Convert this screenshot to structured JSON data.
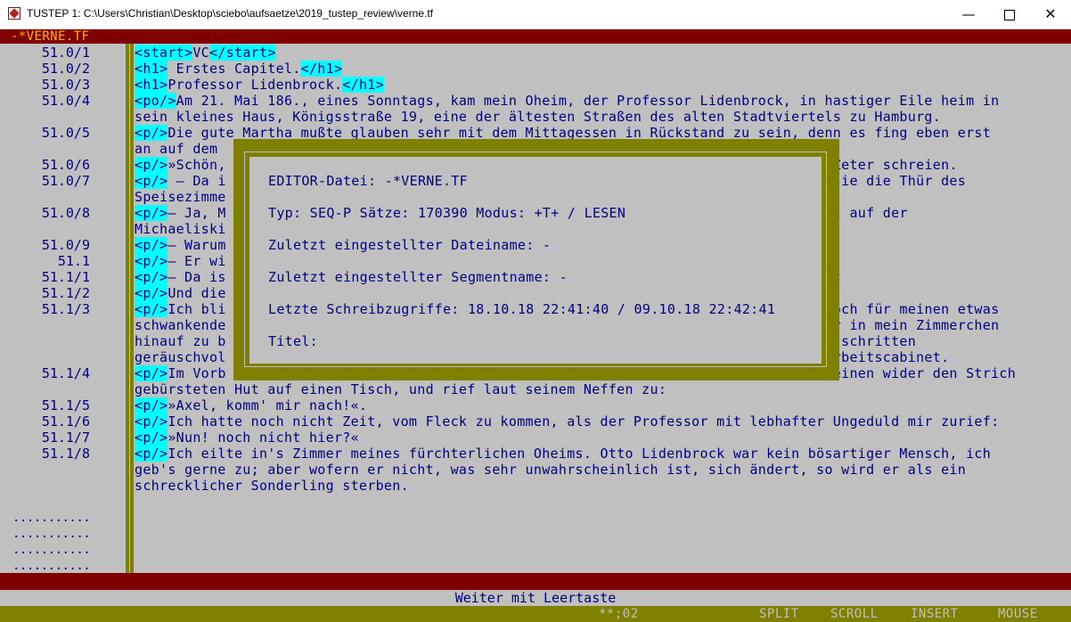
{
  "window": {
    "title": "TUSTEP 1: C:\\Users\\Christian\\Desktop\\sciebo\\aufsaetze\\2019_tustep_review\\verne.tf",
    "minimize": "—",
    "close": "✕"
  },
  "file_label": "-*VERNE.TF",
  "lines": [
    {
      "num": "51.0/1",
      "segs": [
        {
          "t": "<start>",
          "tag": true
        },
        {
          "t": "VC"
        },
        {
          "t": "</start>",
          "tag": true
        }
      ]
    },
    {
      "num": "51.0/2",
      "segs": [
        {
          "t": "<h1>",
          "tag": true
        },
        {
          "t": " Erstes Capitel."
        },
        {
          "t": "</h1>",
          "tag": true
        }
      ]
    },
    {
      "num": "51.0/3",
      "segs": [
        {
          "t": "<h1>",
          "tag": true
        },
        {
          "t": "Professor Lidenbrock."
        },
        {
          "t": "</h1>",
          "tag": true
        }
      ]
    },
    {
      "num": "51.0/4",
      "segs": [
        {
          "t": "<po/>",
          "tag": true
        },
        {
          "t": "Am 21. Mai 186., eines Sonntags, kam mein Oheim, der Professor Lidenbrock, in hastiger Eile heim in"
        }
      ]
    },
    {
      "num": "",
      "segs": [
        {
          "t": "sein kleines Haus, Königsstraße 19, eine der ältesten Straßen des alten Stadtviertels zu Hamburg."
        }
      ]
    },
    {
      "num": "51.0/5",
      "segs": [
        {
          "t": "<p/>",
          "tag": true
        },
        {
          "t": "Die gute Martha mußte glauben sehr mit dem Mittagessen in Rückstand zu sein, denn es fing eben erst"
        }
      ]
    },
    {
      "num": "",
      "segs": [
        {
          "t": "an auf dem"
        }
      ]
    },
    {
      "num": "51.0/6",
      "segs": [
        {
          "t": "<p/>",
          "tag": true
        },
        {
          "t": "»Schön,"
        },
        {
          "t": "                                                                      nn Zeter schreien."
        }
      ]
    },
    {
      "num": "51.0/7",
      "segs": [
        {
          "t": "<p/>",
          "tag": true
        },
        {
          "t": " – Da i"
        },
        {
          "t": "                                                                      em sie die Thür des"
        }
      ]
    },
    {
      "num": "",
      "segs": [
        {
          "t": "Speisezimme"
        }
      ]
    },
    {
      "num": "51.0/8",
      "segs": [
        {
          "t": "<p/>",
          "tag": true
        },
        {
          "t": "– Ja, M"
        },
        {
          "t": "                                                                      erst auf der"
        }
      ]
    },
    {
      "num": "",
      "segs": [
        {
          "t": "Michaeliski"
        }
      ]
    },
    {
      "num": "51.0/9",
      "segs": [
        {
          "t": "<p/>",
          "tag": true
        },
        {
          "t": "– Warum"
        }
      ]
    },
    {
      "num": "51.1",
      "segs": [
        {
          "t": "<p/>",
          "tag": true
        },
        {
          "t": "– Er wi"
        }
      ]
    },
    {
      "num": "51.1/1",
      "segs": [
        {
          "t": "<p/>",
          "tag": true
        },
        {
          "t": "– Da is"
        },
        {
          "t": "                                                                      en.«"
        }
      ]
    },
    {
      "num": "51.1/2",
      "segs": [
        {
          "t": "<p/>",
          "tag": true
        },
        {
          "t": "Und die"
        }
      ]
    },
    {
      "num": "51.1/3",
      "segs": [
        {
          "t": "<p/>",
          "tag": true
        },
        {
          "t": "Ich bli"
        },
        {
          "t": "                                                                      r doch für meinen etwas"
        }
      ]
    },
    {
      "num": "",
      "segs": [
        {
          "t": "schwankende"
        },
        {
          "t": "                                                                      eder in mein Zimmerchen"
        }
      ]
    },
    {
      "num": "",
      "segs": [
        {
          "t": "hinauf zu b"
        },
        {
          "t": "                                                                      ine schritten"
        }
      ]
    },
    {
      "num": "",
      "segs": [
        {
          "t": "geräuschvol"
        },
        {
          "t": "                                                                      n Arbeitscabinet."
        }
      ]
    },
    {
      "num": "51.1/4",
      "segs": [
        {
          "t": "<p/>",
          "tag": true
        },
        {
          "t": "Im Vorb"
        },
        {
          "t": "                                                                      , seinen wider den Strich"
        }
      ]
    },
    {
      "num": "",
      "segs": [
        {
          "t": "gebürsteten Hut auf einen Tisch, und rief laut seinem Neffen zu:"
        }
      ]
    },
    {
      "num": "51.1/5",
      "segs": [
        {
          "t": "<p/>",
          "tag": true
        },
        {
          "t": "»Axel, komm' mir nach!«."
        }
      ]
    },
    {
      "num": "51.1/6",
      "segs": [
        {
          "t": "<p/>",
          "tag": true
        },
        {
          "t": "Ich hatte noch nicht Zeit, vom Fleck zu kommen, als der Professor mit lebhafter Ungeduld mir zurief:"
        }
      ]
    },
    {
      "num": "51.1/7",
      "segs": [
        {
          "t": "<p/>",
          "tag": true
        },
        {
          "t": "»Nun! noch nicht hier?«"
        }
      ]
    },
    {
      "num": "51.1/8",
      "segs": [
        {
          "t": "<p/>",
          "tag": true
        },
        {
          "t": "Ich eilte in's Zimmer meines fürchterlichen Oheims. Otto Lidenbrock war kein bösartiger Mensch, ich"
        }
      ]
    },
    {
      "num": "",
      "segs": [
        {
          "t": "geb's gerne zu; aber wofern er nicht, was sehr unwahrscheinlich ist, sich ändert, so wird er als ein"
        }
      ]
    },
    {
      "num": "",
      "segs": [
        {
          "t": "schrecklicher Sonderling sterben."
        }
      ]
    }
  ],
  "empty_markers": [
    "...........",
    "...........",
    "...........",
    "...........",
    "..........."
  ],
  "dialog": {
    "file": "EDITOR-Datei: -*VERNE.TF",
    "type": "Typ: SEQ-P    Sätze: 170390        Modus: +T+ / LESEN",
    "last_file": "Zuletzt eingestellter Dateiname:   -",
    "last_segment": "Zuletzt eingestellter Segmentname: -",
    "last_write": "Letzte Schreibzugriffe: 18.10.18 22:41:40 / 09.10.18 22:42:41",
    "title": "Titel:"
  },
  "prompt": "Weiter mit Leertaste",
  "status": {
    "position": "**;02",
    "split": "SPLIT",
    "scroll": "SCROLL",
    "insert": "INSERT",
    "mouse": "MOUSE"
  },
  "colors": {
    "background": "#c0c0c0",
    "text": "#000080",
    "tag_highlight": "#00ffff",
    "bar_red": "#800000",
    "bar_olive": "#808000",
    "file_label": "#ffb000"
  }
}
